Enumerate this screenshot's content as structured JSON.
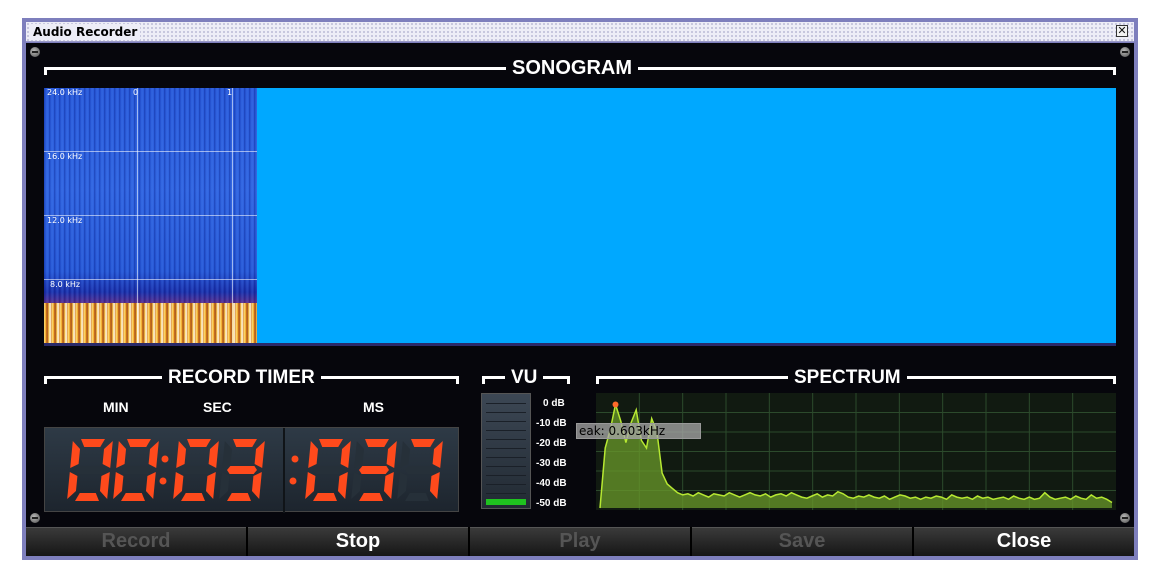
{
  "window": {
    "title": "Audio Recorder",
    "close_glyph": "✕"
  },
  "sonogram": {
    "title": "SONOGRAM",
    "freq_labels": [
      "24.0 kHz",
      "16.0 kHz",
      "12.0 kHz",
      "8.0 kHz"
    ],
    "time_ticks": [
      "0",
      "1"
    ],
    "background_color": "#00a8ff"
  },
  "timer": {
    "title": "RECORD TIMER",
    "labels": {
      "min": "MIN",
      "sec": "SEC",
      "ms": "MS"
    },
    "value": {
      "min": "00",
      "sec": "03",
      "ms": "037"
    },
    "digit_color": "#ff4a1c"
  },
  "vu": {
    "title": "VU",
    "db_labels": [
      "0 dB",
      "-10 dB",
      "-20 dB",
      "-30 dB",
      "-40 dB",
      "-50 dB"
    ],
    "level_fraction": 0.05,
    "fill_color": "#1fc21f"
  },
  "spectrum": {
    "title": "SPECTRUM",
    "peak_tooltip": "eak: 0.603kHz",
    "line_color": "#b6e832",
    "fill_color": "#6a9a2a",
    "peak_marker_color": "#ff6a2a",
    "magnitudes": [
      0.0,
      0.55,
      0.72,
      0.95,
      0.8,
      0.6,
      0.78,
      0.9,
      0.62,
      0.55,
      0.82,
      0.7,
      0.32,
      0.22,
      0.18,
      0.14,
      0.12,
      0.13,
      0.11,
      0.14,
      0.12,
      0.1,
      0.13,
      0.12,
      0.11,
      0.14,
      0.12,
      0.1,
      0.12,
      0.14,
      0.12,
      0.11,
      0.13,
      0.1,
      0.12,
      0.13,
      0.11,
      0.14,
      0.12,
      0.1,
      0.09,
      0.11,
      0.13,
      0.1,
      0.12,
      0.11,
      0.15,
      0.13,
      0.1,
      0.09,
      0.11,
      0.1,
      0.12,
      0.1,
      0.09,
      0.11,
      0.08,
      0.1,
      0.12,
      0.11,
      0.09,
      0.1,
      0.08,
      0.1,
      0.09,
      0.11,
      0.1,
      0.08,
      0.12,
      0.1,
      0.09,
      0.1,
      0.08,
      0.11,
      0.09,
      0.1,
      0.08,
      0.09,
      0.1,
      0.08,
      0.11,
      0.09,
      0.08,
      0.1,
      0.08,
      0.09,
      0.14,
      0.1,
      0.08,
      0.09,
      0.1,
      0.08,
      0.11,
      0.09,
      0.08,
      0.12,
      0.09,
      0.1,
      0.08,
      0.05
    ]
  },
  "buttons": [
    {
      "label": "Record",
      "enabled": false
    },
    {
      "label": "Stop",
      "enabled": true
    },
    {
      "label": "Play",
      "enabled": false
    },
    {
      "label": "Save",
      "enabled": false
    },
    {
      "label": "Close",
      "enabled": true
    }
  ]
}
